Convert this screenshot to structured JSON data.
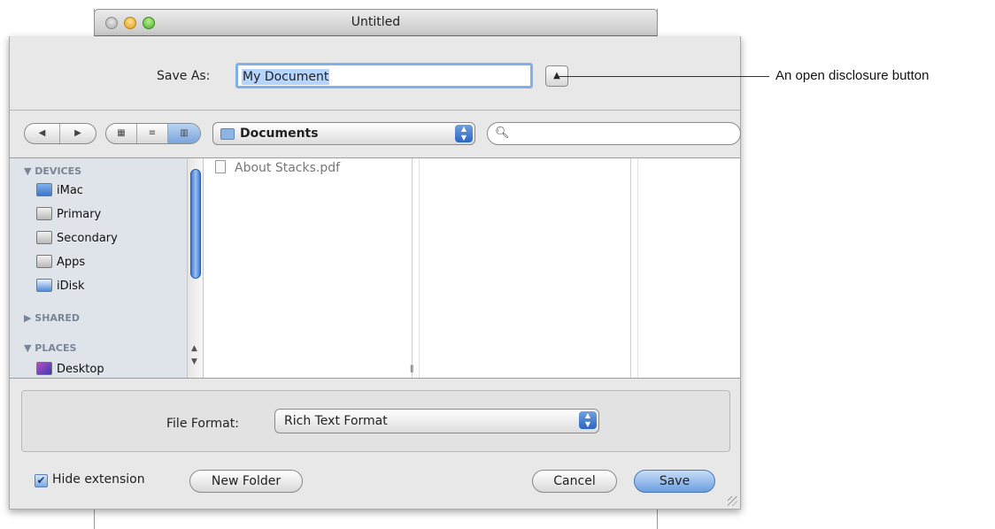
{
  "window": {
    "title": "Untitled"
  },
  "save_as": {
    "label": "Save As:",
    "value": "My Document"
  },
  "toolbar": {
    "location": "Documents"
  },
  "sidebar": {
    "devices_header": "▼ DEVICES",
    "devices": [
      "iMac",
      "Primary",
      "Secondary",
      "Apps",
      "iDisk"
    ],
    "shared_header": "▶ SHARED",
    "places_header": "▼ PLACES",
    "places": [
      "Desktop"
    ]
  },
  "files": [
    "About Stacks.pdf"
  ],
  "format": {
    "label": "File Format:",
    "value": "Rich Text Format"
  },
  "bottom": {
    "hide_extension": "Hide extension",
    "new_folder": "New Folder",
    "cancel": "Cancel",
    "save": "Save"
  },
  "annotation": {
    "text": "An open disclosure button"
  }
}
